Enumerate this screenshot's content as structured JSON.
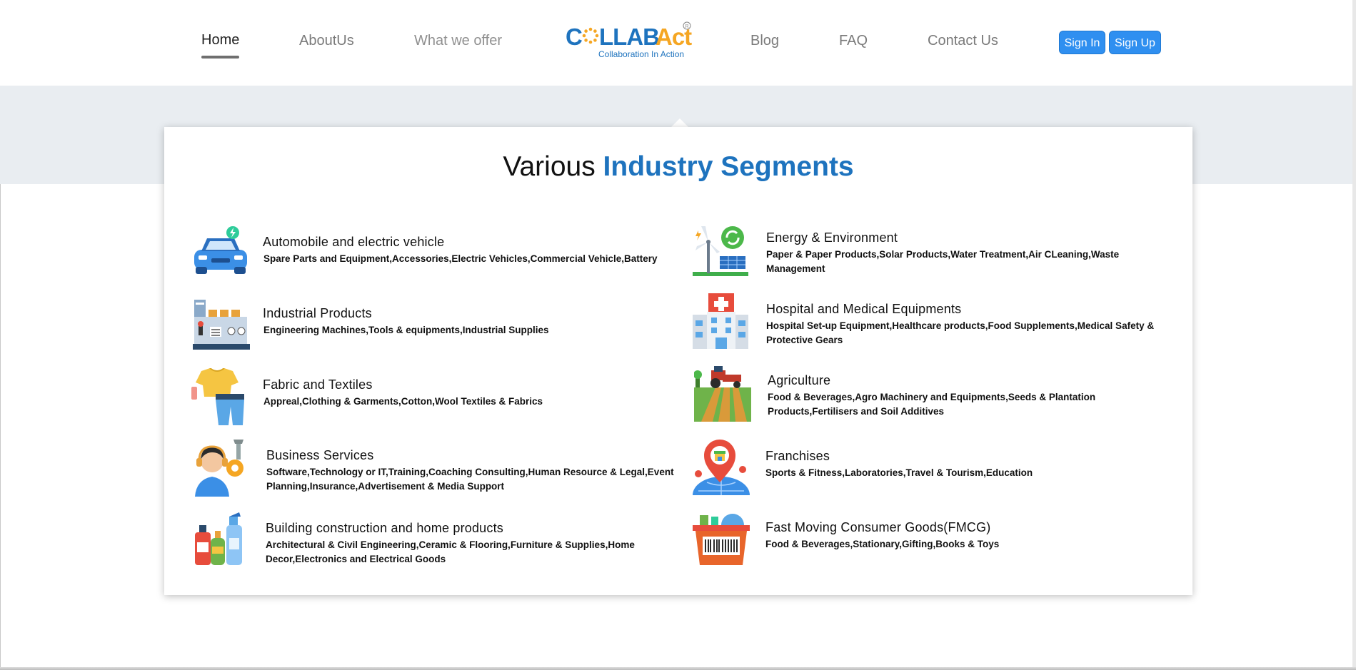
{
  "nav": {
    "items": [
      {
        "label": "Home"
      },
      {
        "label": "AboutUs"
      },
      {
        "label": "What we offer"
      },
      {
        "label": "Blog"
      },
      {
        "label": "FAQ"
      },
      {
        "label": "Contact Us"
      }
    ],
    "active": "Home",
    "sign_in": "Sign In",
    "sign_up": "Sign Up"
  },
  "logo": {
    "wordmark": "COLLABAct",
    "tagline": "Collaboration In Action",
    "registered": "R"
  },
  "section": {
    "title_plain": "Various",
    "title_highlight": "Industry Segments"
  },
  "segments": [
    {
      "title": "Automobile and electric vehicle",
      "desc": "Spare Parts and Equipment,Accessories,Electric Vehicles,Commercial Vehicle,Battery",
      "icon": "electric-car-icon"
    },
    {
      "title": "Energy & Environment",
      "desc": "Paper & Paper Products,Solar Products,Water Treatment,Air CLeaning,Waste Management",
      "icon": "wind-solar-icon"
    },
    {
      "title": "Industrial Products",
      "desc": "Engineering Machines,Tools & equipments,Industrial Supplies",
      "icon": "industrial-machine-icon"
    },
    {
      "title": "Hospital and Medical Equipments",
      "desc": "Hospital Set-up Equipment,Healthcare products,Food Supplements,Medical Safety & Protective Gears",
      "icon": "hospital-icon"
    },
    {
      "title": "Fabric and Textiles",
      "desc": "Appreal,Clothing & Garments,Cotton,Wool Textiles & Fabrics",
      "icon": "clothing-icon"
    },
    {
      "title": "Agriculture",
      "desc": "Food & Beverages,Agro Machinery and Equipments,Seeds & Plantation Products,Fertilisers and Soil Additives",
      "icon": "tractor-field-icon"
    },
    {
      "title": "Business Services",
      "desc": "Software,Technology or IT,Training,Coaching Consulting,Human Resource & Legal,Event Planning,Insurance,Advertisement & Media Support",
      "icon": "support-agent-icon"
    },
    {
      "title": "Franchises",
      "desc": "Sports & Fitness,Laboratories,Travel & Tourism,Education",
      "icon": "franchise-location-icon"
    },
    {
      "title": "Building construction and home products",
      "desc": "Architectural & Civil Engineering,Ceramic & Flooring,Furniture & Supplies,Home Decor,Electronics and Electrical Goods",
      "icon": "cleaning-products-icon"
    },
    {
      "title": "Fast Moving Consumer Goods(FMCG)",
      "desc": "Food & Beverages,Stationary,Gifting,Books & Toys",
      "icon": "shopping-basket-icon"
    }
  ]
}
